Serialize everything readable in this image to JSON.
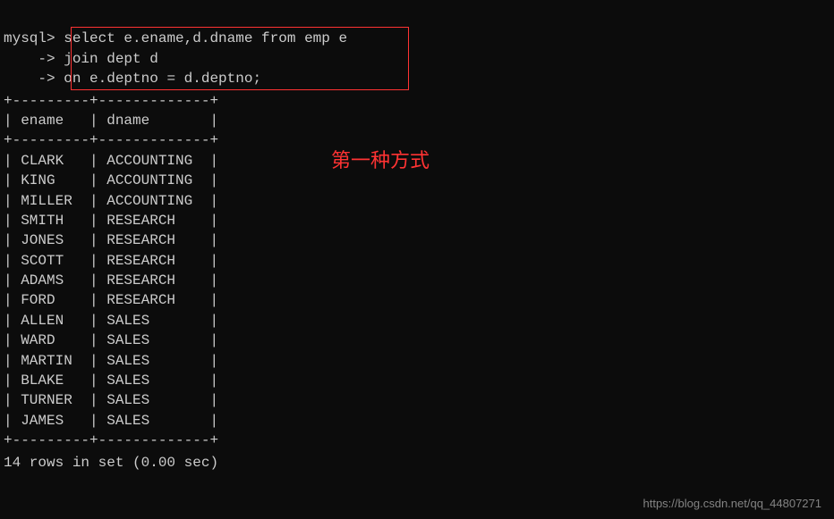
{
  "top_fragment": "                                       ",
  "prompt": {
    "main": "mysql>",
    "cont": "    ->",
    "sql_line1": "select e.ename,d.dname from emp e",
    "sql_line2": "join dept d",
    "sql_line3": "on e.deptno = d.deptno;"
  },
  "annotation": "第一种方式",
  "table": {
    "header": {
      "col1": "ename",
      "col2": "dname"
    },
    "rows": [
      {
        "ename": "CLARK",
        "dname": "ACCOUNTING"
      },
      {
        "ename": "KING",
        "dname": "ACCOUNTING"
      },
      {
        "ename": "MILLER",
        "dname": "ACCOUNTING"
      },
      {
        "ename": "SMITH",
        "dname": "RESEARCH"
      },
      {
        "ename": "JONES",
        "dname": "RESEARCH"
      },
      {
        "ename": "SCOTT",
        "dname": "RESEARCH"
      },
      {
        "ename": "ADAMS",
        "dname": "RESEARCH"
      },
      {
        "ename": "FORD",
        "dname": "RESEARCH"
      },
      {
        "ename": "ALLEN",
        "dname": "SALES"
      },
      {
        "ename": "WARD",
        "dname": "SALES"
      },
      {
        "ename": "MARTIN",
        "dname": "SALES"
      },
      {
        "ename": "BLAKE",
        "dname": "SALES"
      },
      {
        "ename": "TURNER",
        "dname": "SALES"
      },
      {
        "ename": "JAMES",
        "dname": "SALES"
      }
    ]
  },
  "footer": "14 rows in set (0.00 sec)",
  "watermark": "https://blog.csdn.net/qq_44807271"
}
